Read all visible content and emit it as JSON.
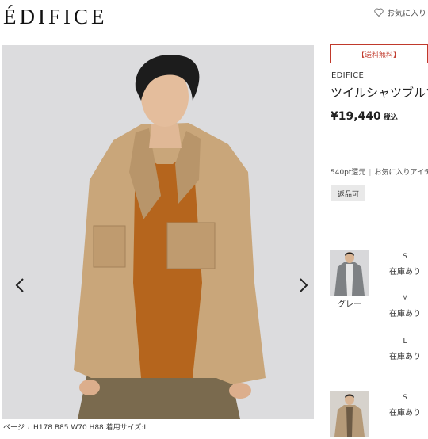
{
  "header": {
    "logo": "ÉDIFICE",
    "favorite_label": "お気に入り"
  },
  "gallery": {
    "prev_icon": "chevron-left-icon",
    "next_icon": "chevron-right-icon",
    "caption": "ベージュ H178 B85 W70 H88 着用サイズ:L"
  },
  "product": {
    "badge": "【送料無料】",
    "brand": "EDIFICE",
    "name": "ツイルシャツブルゾン",
    "price": "¥19,440",
    "tax_label": "税込",
    "points": "540pt還元",
    "points_fav": "お気に入りアイテム",
    "return_label": "返品可"
  },
  "variants": [
    {
      "color": "グレー",
      "sizes": [
        {
          "size": "S",
          "stock": "在庫あり"
        },
        {
          "size": "M",
          "stock": "在庫あり"
        },
        {
          "size": "L",
          "stock": "在庫あり"
        }
      ]
    },
    {
      "color": "",
      "sizes": [
        {
          "size": "S",
          "stock": "在庫あり"
        }
      ]
    }
  ],
  "colors": {
    "accent": "#c0392b",
    "jacket": "#c9a67a",
    "sweater": "#b5651d",
    "background": "#dcdcde"
  }
}
